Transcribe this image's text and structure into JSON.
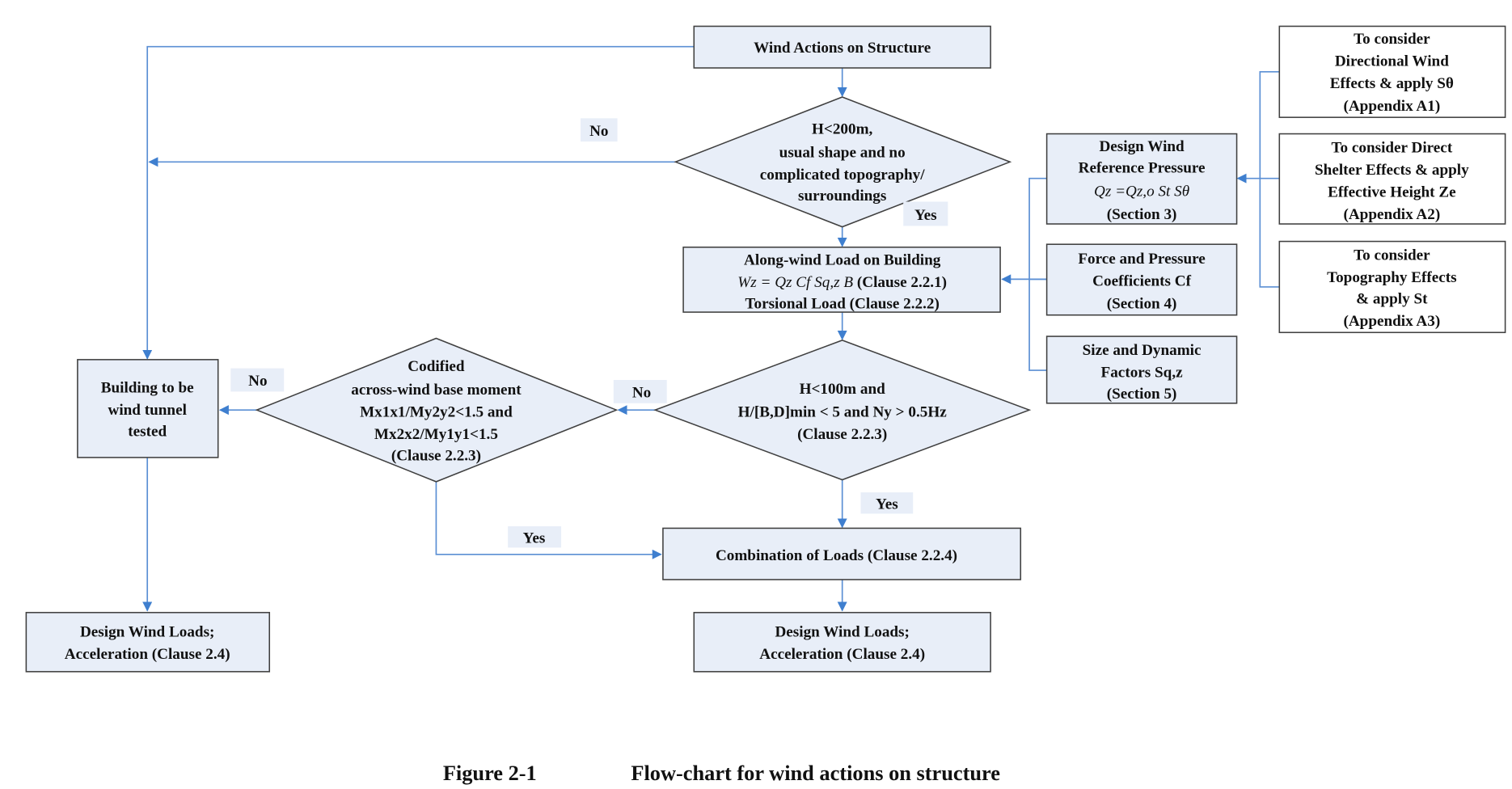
{
  "figure": {
    "caption_number": "Figure 2-1",
    "caption_title": "Flow-chart for wind actions on structure"
  },
  "nodes": {
    "start": {
      "lines": [
        "Wind Actions on Structure"
      ]
    },
    "decision1": {
      "lines": [
        "H<200m,",
        "usual shape and no",
        "complicated topography/",
        "surroundings"
      ]
    },
    "along_wind": {
      "line1": "Along-wind Load on Building",
      "formula": "Wz = Qz Cf Sq,z B",
      "clause": " (Clause 2.2.1)",
      "line3": "Torsional Load (Clause 2.2.2)"
    },
    "decision2": {
      "lines": [
        "H<100m and",
        "H/[B,D]min < 5 and Ny > 0.5Hz",
        "(Clause 2.2.3)"
      ]
    },
    "decision3": {
      "lines": [
        "Codified",
        "across-wind base moment",
        "Mx1x1/My2y2<1.5 and",
        "Mx2x2/My1y1<1.5",
        "(Clause 2.2.3)"
      ]
    },
    "wind_tunnel": {
      "lines": [
        "Building to be",
        "wind tunnel",
        "tested"
      ]
    },
    "combination": {
      "lines": [
        "Combination of Loads (Clause 2.2.4)"
      ]
    },
    "design_right": {
      "lines": [
        "Design Wind Loads;",
        "Acceleration (Clause 2.4)"
      ]
    },
    "design_left": {
      "lines": [
        "Design Wind Loads;",
        "Acceleration (Clause 2.4)"
      ]
    },
    "ref_pressure": {
      "lines": [
        "Design Wind",
        "Reference Pressure",
        "Qz =Qz,o St Sθ",
        "(Section 3)"
      ]
    },
    "force_coeff": {
      "lines": [
        "Force and Pressure",
        "Coefficients Cf",
        "(Section 4)"
      ]
    },
    "size_dynamic": {
      "lines": [
        "Size and Dynamic",
        "Factors Sq,z",
        "(Section 5)"
      ]
    },
    "appendix_a1": {
      "lines": [
        "To consider",
        "Directional Wind",
        "Effects & apply Sθ",
        "(Appendix A1)"
      ]
    },
    "appendix_a2": {
      "lines": [
        "To consider Direct",
        "Shelter Effects & apply",
        "Effective Height Ze",
        "(Appendix A2)"
      ]
    },
    "appendix_a3": {
      "lines": [
        "To consider",
        "Topography Effects",
        "& apply St",
        "(Appendix A3)"
      ]
    }
  },
  "edge_labels": {
    "d1_no": "No",
    "d1_yes": "Yes",
    "d2_no": "No",
    "d2_yes": "Yes",
    "d3_no": "No",
    "d3_yes": "Yes"
  },
  "colors": {
    "box_fill": "#e8eef8",
    "connector": "#5b8fd4",
    "border": "#404040"
  }
}
